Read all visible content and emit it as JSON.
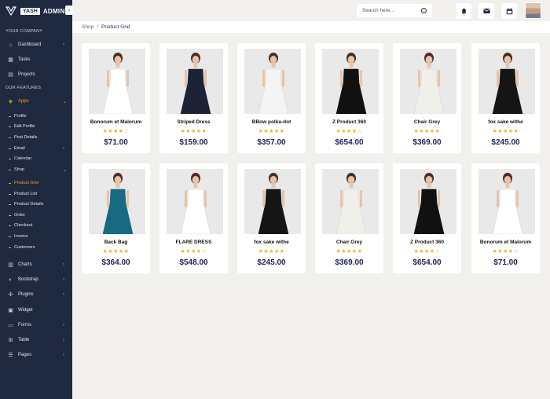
{
  "brand": {
    "box": "YASH",
    "text": "ADMIN"
  },
  "sidebar": {
    "section_company": "YOUR COMPANY",
    "section_features": "OUR FEATURES",
    "dashboard": "Dashboard",
    "tasks": "Tasks",
    "projects": "Projects",
    "apps": "Apps",
    "subitems": {
      "profile": "Profile",
      "edit_profile": "Edit Profile",
      "post_details": "Post Details",
      "email": "Email",
      "calendar": "Calendar",
      "shop": "Shop",
      "product_grid": "Product Grid",
      "product_list": "Product List",
      "product_details": "Product Details",
      "order": "Order",
      "checkout": "Checkout",
      "invoice": "Invoice",
      "customers": "Customers"
    },
    "charts": "Charts",
    "bootstrap": "Bootstrap",
    "plugins": "Plugins",
    "widget": "Widget",
    "forms": "Forms",
    "table": "Table",
    "pages": "Pages",
    "active_color": "#f0a51d"
  },
  "header": {
    "search_placeholder": "Search here..."
  },
  "breadcrumb": {
    "shop": "Shop",
    "sep": "/",
    "current": "Product Grid"
  },
  "products": [
    {
      "name": "Bonorum et Malorum",
      "stars": "★★★★☆",
      "rating": 4,
      "price": "$71.00",
      "dress": "#ffffff"
    },
    {
      "name": "Striped Dress",
      "stars": "★★★★★",
      "rating": 5,
      "price": "$159.00",
      "dress": "#1c2336"
    },
    {
      "name": "BBow polka-dot",
      "stars": "★★★★★",
      "rating": 5,
      "price": "$357.00",
      "dress": "#f4f4f4"
    },
    {
      "name": "Z Product 360",
      "stars": "★★★★☆",
      "rating": 4,
      "price": "$654.00",
      "dress": "#111111"
    },
    {
      "name": "Chair Grey",
      "stars": "★★★★★",
      "rating": 5,
      "price": "$369.00",
      "dress": "#f1efe9"
    },
    {
      "name": "fox sake withe",
      "stars": "★★★★★",
      "rating": 5,
      "price": "$245.00",
      "dress": "#151515"
    },
    {
      "name": "Back Bag",
      "stars": "★★★★★",
      "rating": 5,
      "price": "$364.00",
      "dress": "#176a82"
    },
    {
      "name": "FLARE DRESS",
      "stars": "★★★★☆",
      "rating": 4,
      "price": "$548.00",
      "dress": "#ffffff"
    },
    {
      "name": "fox sake withe",
      "stars": "★★★★★",
      "rating": 5,
      "price": "$245.00",
      "dress": "#151515"
    },
    {
      "name": "Chair Grey",
      "stars": "★★★★★",
      "rating": 5,
      "price": "$369.00",
      "dress": "#f1efe9"
    },
    {
      "name": "Z Product 360",
      "stars": "★★★★☆",
      "rating": 4,
      "price": "$654.00",
      "dress": "#111111"
    },
    {
      "name": "Bonorum et Malorum",
      "stars": "★★★★☆",
      "rating": 4,
      "price": "$71.00",
      "dress": "#ffffff"
    }
  ]
}
